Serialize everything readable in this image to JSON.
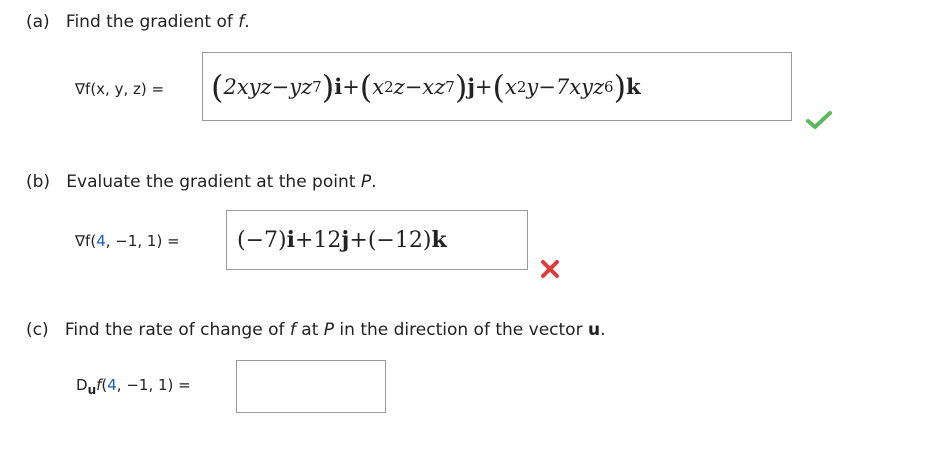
{
  "part_a": {
    "label": "(a)",
    "prompt_text": "Find the gradient of ",
    "prompt_var": "f",
    "prompt_end": ".",
    "lhs_nabla_f": "∇f",
    "lhs_args": "(x, y, z)",
    "lhs_eq": "=",
    "answer": {
      "i_term1": "2xyz",
      "i_minus": " − ",
      "i_term2": "yz",
      "i_exp": "7",
      "i_unit": "i",
      "plus1": " + ",
      "j_term1": "x",
      "j_exp1": "2",
      "j_term1b": "z",
      "j_minus": " − ",
      "j_term2": "xz",
      "j_exp2": "7",
      "j_unit": "j",
      "plus2": " + ",
      "k_term1": "x",
      "k_exp1": "2",
      "k_term1b": "y",
      "k_minus": " − ",
      "k_term2": "7xyz",
      "k_exp2": "6",
      "k_unit": "k"
    },
    "status": "correct",
    "status_color": "#5cb85c"
  },
  "part_b": {
    "label": "(b)",
    "prompt_text": "Evaluate the gradient at the point ",
    "prompt_var": "P",
    "prompt_end": ".",
    "lhs_nabla_f": "∇f",
    "lhs_args_open": "(",
    "lhs_x": "4",
    "lhs_rest": ", −1, 1)",
    "lhs_eq": "=",
    "answer": {
      "i_val": "−7",
      "i_unit": "i",
      "plus1": " + ",
      "j_val": "12",
      "j_unit": "j",
      "plus2": " + ",
      "k_val": "−12",
      "k_unit": "k"
    },
    "status": "incorrect",
    "status_color": "#e03a3a"
  },
  "part_c": {
    "label": "(c)",
    "prompt_text": "Find the rate of change of ",
    "prompt_var1": "f",
    "prompt_mid": " at ",
    "prompt_var2": "P",
    "prompt_mid2": " in the direction of the vector ",
    "prompt_vec": "u",
    "prompt_end": ".",
    "lhs_D": "D",
    "lhs_sub": "u",
    "lhs_f": "f",
    "lhs_open": "(",
    "lhs_x": "4",
    "lhs_rest": ", −1, 1)",
    "lhs_eq": "=",
    "input_value": ""
  },
  "colors": {
    "blue_value": "#1a5fc0",
    "text": "#222222",
    "box_border": "#9a9a9a"
  }
}
